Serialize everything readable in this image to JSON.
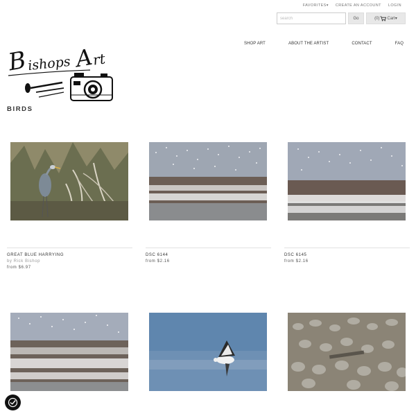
{
  "utility_nav": {
    "favorites": "FAVORITES▾",
    "create_account": "CREATE AN ACCOUNT",
    "login": "LOGIN"
  },
  "search": {
    "placeholder": "search",
    "go_label": "Go",
    "cart_count": "(0)",
    "cart_label": "Cart▾"
  },
  "logo": {
    "text": "Bishops Art"
  },
  "main_nav": [
    "SHOP ART",
    "ABOUT THE ARTIST",
    "CONTACT",
    "FAQ"
  ],
  "page_title": "BIRDS",
  "gallery": [
    {
      "title": "GREAT BLUE HARRYING",
      "byline": "by Rick Bishop",
      "price": "from $6.97",
      "image": "heron"
    },
    {
      "title": "DSC 6144",
      "byline": "",
      "price": "from $2.16",
      "image": "flock-water"
    },
    {
      "title": "DSC 6145",
      "byline": "",
      "price": "from $2.16",
      "image": "flock-water"
    },
    {
      "title": "",
      "byline": "",
      "price": "",
      "image": "flock-water"
    },
    {
      "title": "",
      "byline": "",
      "price": "",
      "image": "snow-goose-flight"
    },
    {
      "title": "",
      "byline": "",
      "price": "",
      "image": "cranes-field"
    }
  ],
  "colors": {
    "accent": "#333333",
    "muted": "#999999",
    "button_bg": "#e8e8e8"
  }
}
